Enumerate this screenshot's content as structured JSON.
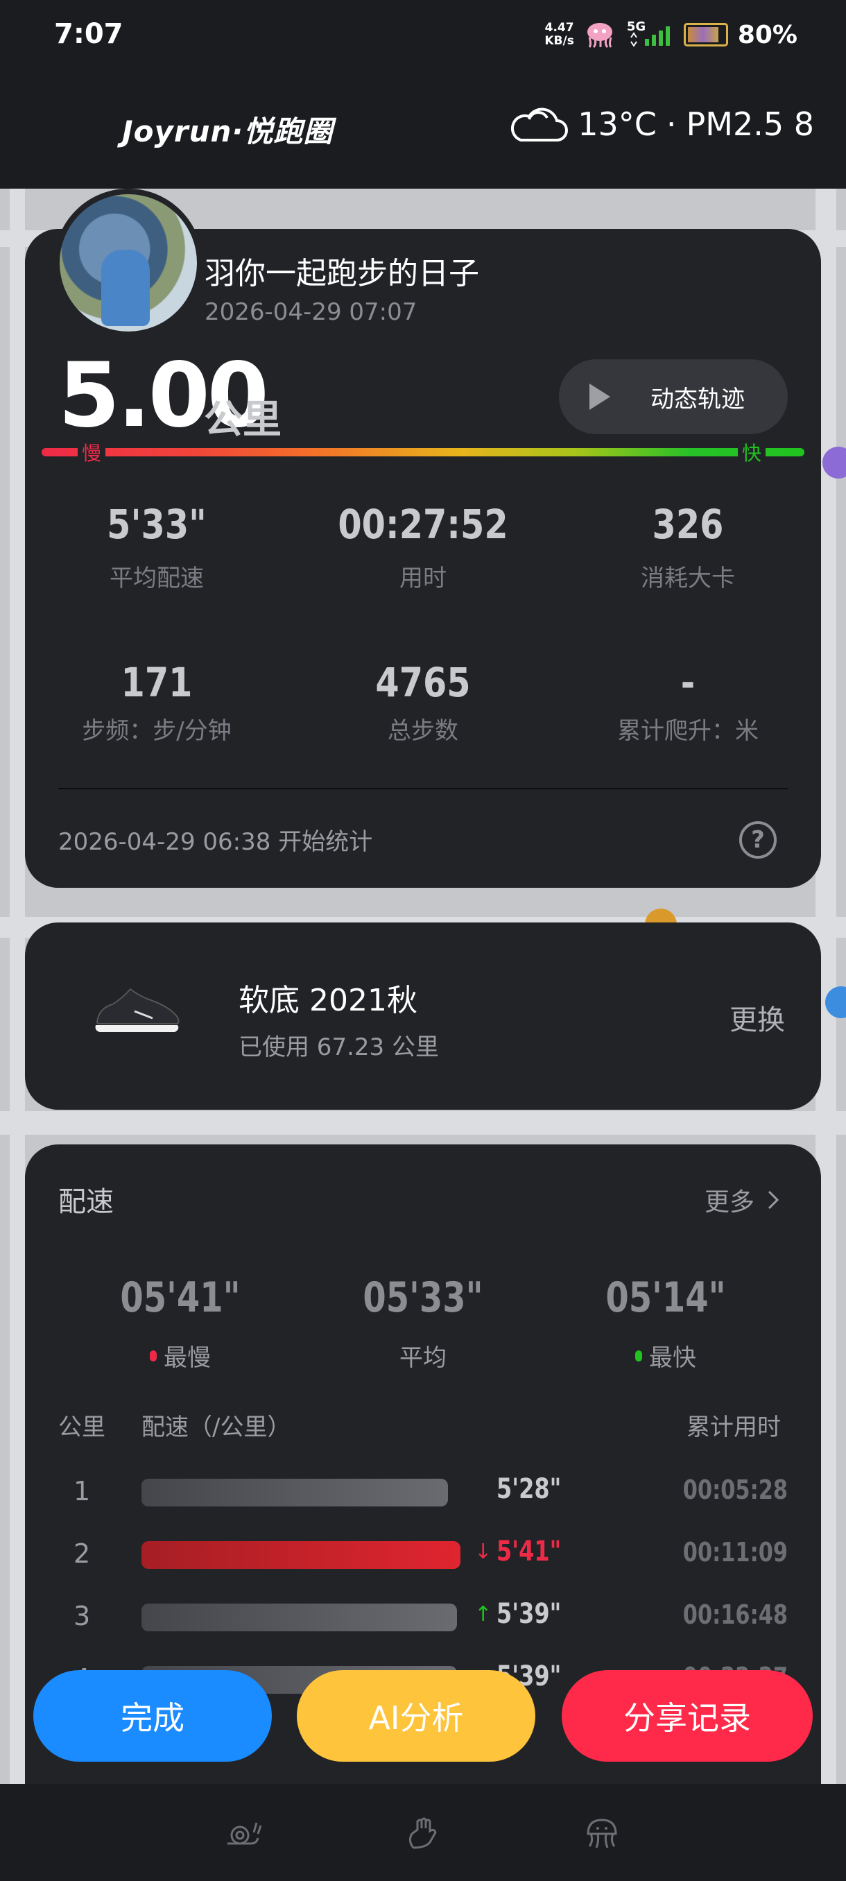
{
  "status_bar": {
    "time": "7:07",
    "net_speed_value": "4.47",
    "net_speed_unit": "KB/s",
    "network": "5G",
    "battery": "80%"
  },
  "header": {
    "logo": "Joyrun·悦跑圈",
    "temperature": "13°C",
    "separator": "·",
    "pm25": "PM2.5 8",
    "weather_icon": "cloud-icon"
  },
  "run": {
    "title": "羽你一起跑步的日子",
    "datetime": "2026-04-29 07:07",
    "distance": "5.00",
    "distance_unit": "公里",
    "track_button": "动态轨迹",
    "slow_label": "慢",
    "fast_label": "快",
    "stats": [
      {
        "value": "5'33\"",
        "label": "平均配速"
      },
      {
        "value": "00:27:52",
        "label": "用时"
      },
      {
        "value": "326",
        "label": "消耗大卡"
      },
      {
        "value": "171",
        "label": "步频：步/分钟"
      },
      {
        "value": "4765",
        "label": "总步数"
      },
      {
        "value": "-",
        "label": "累计爬升：米"
      }
    ],
    "start_stat": "2026-04-29 06:38  开始统计",
    "help": "?"
  },
  "shoe": {
    "name": "软底 2021秋",
    "used": "已使用 67.23 公里",
    "change": "更换"
  },
  "pace": {
    "title": "配速",
    "more": "更多",
    "summary": [
      {
        "value": "05'41\"",
        "label": "最慢",
        "dot_color": "#ef2a47"
      },
      {
        "value": "05'33\"",
        "label": "平均",
        "dot_color": ""
      },
      {
        "value": "05'14\"",
        "label": "最快",
        "dot_color": "#20c320"
      }
    ],
    "headers": {
      "km": "公里",
      "pace": "配速（/公里）",
      "cumulative": "累计用时"
    },
    "rows": [
      {
        "km": "1",
        "pace": "5'28\"",
        "cumulative": "00:05:28",
        "fill": 0.96,
        "color": "#55565c",
        "arrow": "",
        "pace_color": "#c9cace"
      },
      {
        "km": "2",
        "pace": "5'41\"",
        "cumulative": "00:11:09",
        "fill": 1.0,
        "color": "#e0252f",
        "arrow": "↓",
        "pace_color": "#ef2a47"
      },
      {
        "km": "3",
        "pace": "5'39\"",
        "cumulative": "00:16:48",
        "fill": 0.99,
        "color": "#55565c",
        "arrow": "↑",
        "pace_color": "#c9cace"
      },
      {
        "km": "4",
        "pace": "5'39\"",
        "cumulative": "00:22:27",
        "fill": 0.99,
        "color": "#55565c",
        "arrow": "",
        "pace_color": "#c9cace"
      }
    ]
  },
  "buttons": {
    "done": "完成",
    "ai": "AI分析",
    "share": "分享记录"
  },
  "nav": [
    "snail-icon",
    "hand-icon",
    "jellyfish-icon"
  ]
}
